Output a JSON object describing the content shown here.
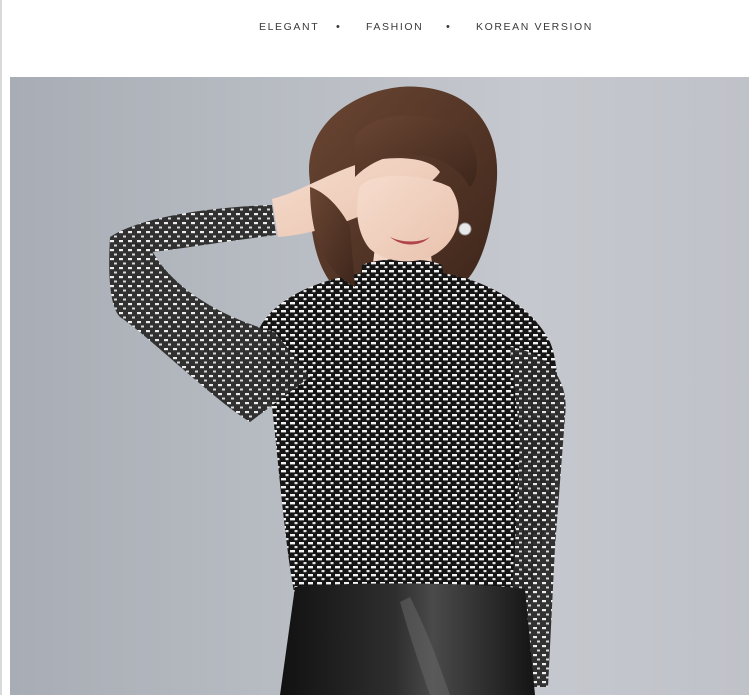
{
  "tagline": {
    "items": [
      "ELEGANT",
      "FASHION",
      "KOREAN VERSION"
    ],
    "separator": "•"
  },
  "photo": {
    "subject": "woman in turtleneck mesh top with black-white dash print and black leather skirt, hand over eyes",
    "background_color": "#b7bbc2",
    "top_color": "#1a1a1a",
    "print_color": "#ffffff",
    "skin_color": "#f1d3c3",
    "hair_color": "#5a3a2a"
  }
}
